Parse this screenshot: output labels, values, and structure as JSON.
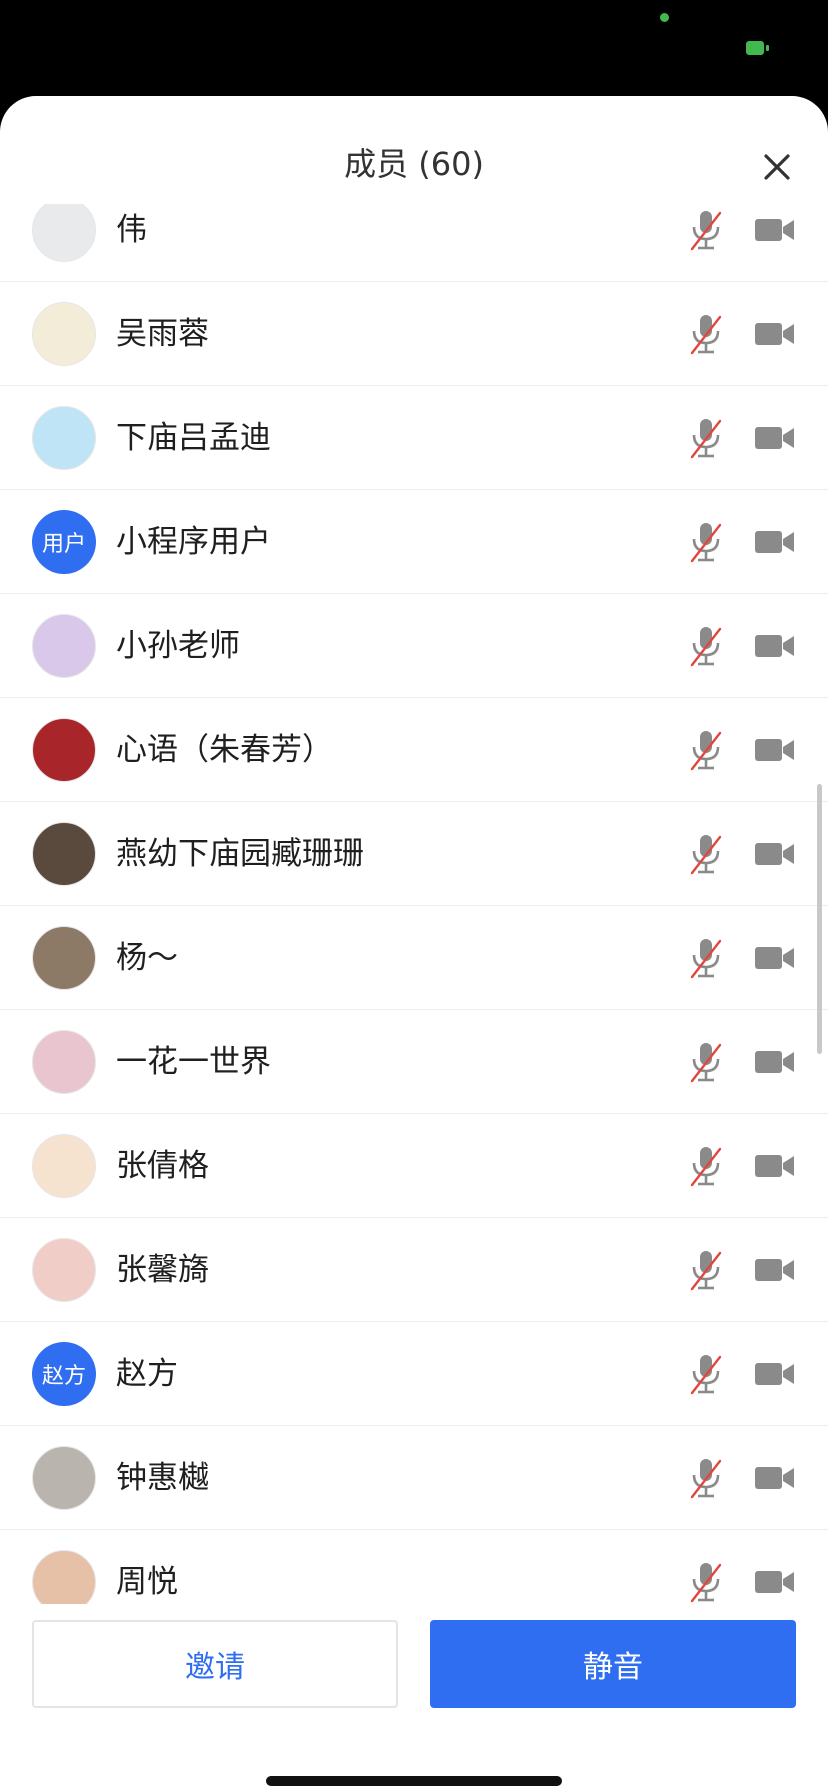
{
  "sheet": {
    "title": "成员 (60)"
  },
  "members": [
    {
      "name": "伟",
      "avatar": "photo",
      "avatar_color": "#e8eaec"
    },
    {
      "name": "吴雨蓉",
      "avatar": "photo",
      "avatar_color": "#f3ecd9"
    },
    {
      "name": "下庙吕孟迪",
      "avatar": "photo",
      "avatar_color": "#bfe4f6"
    },
    {
      "name": "小程序用户",
      "avatar": "text",
      "avatar_text": "用户"
    },
    {
      "name": "小孙老师",
      "avatar": "photo",
      "avatar_color": "#d9c8ea"
    },
    {
      "name": "心语（朱春芳）",
      "avatar": "photo",
      "avatar_color": "#a8262a"
    },
    {
      "name": "燕幼下庙园臧珊珊",
      "avatar": "photo",
      "avatar_color": "#5a4a3e"
    },
    {
      "name": "杨～",
      "avatar": "photo",
      "avatar_color": "#8c7a66"
    },
    {
      "name": "一花一世界",
      "avatar": "photo",
      "avatar_color": "#e9c6cf"
    },
    {
      "name": "张倩格",
      "avatar": "photo",
      "avatar_color": "#f6e3cf"
    },
    {
      "name": "张馨旖",
      "avatar": "photo",
      "avatar_color": "#f0cdc6"
    },
    {
      "name": "赵方",
      "avatar": "text",
      "avatar_text": "赵方"
    },
    {
      "name": "钟惠樾",
      "avatar": "photo",
      "avatar_color": "#b9b4ad"
    },
    {
      "name": "周悦",
      "avatar": "photo",
      "avatar_color": "#e6c1a8"
    }
  ],
  "footer": {
    "invite_label": "邀请",
    "mute_label": "静音"
  },
  "colors": {
    "accent": "#2f6ef0",
    "muted_mic_slash": "#e0473f",
    "icon_gray": "#8a8a8a"
  },
  "icons": {
    "close": "close-icon",
    "mic": "microphone-off-icon",
    "video": "video-camera-icon"
  }
}
